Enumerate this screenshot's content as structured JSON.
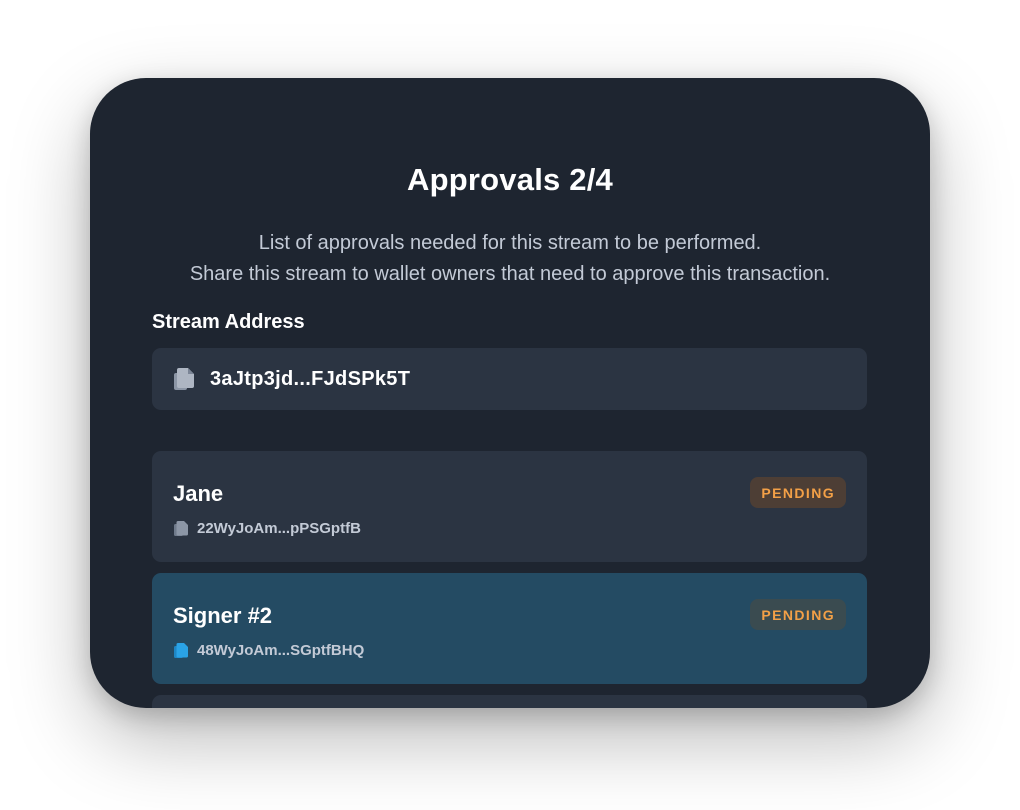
{
  "dialog": {
    "title": "Approvals 2/4",
    "description_line1": "List of approvals needed for this stream to be performed.",
    "description_line2": "Share this stream to wallet owners that need to approve this transaction."
  },
  "stream_address": {
    "label": "Stream Address",
    "value": "3aJtp3jd...FJdSPk5T",
    "icon": "copy-icon"
  },
  "signers": [
    {
      "name": "Jane",
      "address": "22WyJoAm...pPSGptfB",
      "status": "PENDING",
      "icon_color": "#8c96a6",
      "selected": false
    },
    {
      "name": "Signer #2",
      "address": "48WyJoAm...SGptfBHQ",
      "status": "PENDING",
      "icon_color": "#2aa3e6",
      "selected": true
    }
  ],
  "colors": {
    "background": "#1e2530",
    "card": "#2b3442",
    "card_selected": "#244b63",
    "pending": "#f3a047",
    "copy_icon_accent": "#2aa3e6"
  }
}
